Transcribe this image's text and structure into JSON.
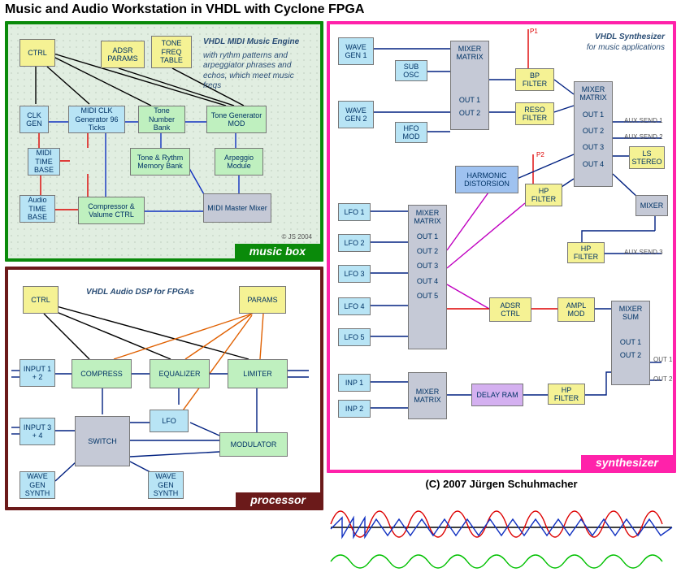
{
  "title": "Music and Audio Workstation in VHDL with Cyclone FPGA",
  "copyright": "(C) 2007 Jürgen Schuhmacher",
  "music_box": {
    "badge": "music box",
    "desc_title": "VHDL MIDI Music Engine",
    "desc_body": "with rythm patterns and arpeggiator phrases and echos, which meet music freqs",
    "footer": "© JS 2004",
    "b": {
      "ctrl": "CTRL",
      "adsr": "ADSR PARAMS",
      "tone_tab": "TONE FREQ TABLE",
      "clk": "CLK GEN",
      "midi_clk": "MIDI CLK Generator 96 Ticks",
      "tone_num": "Tone Number Bank",
      "tone_gen": "Tone Generator MOD",
      "midi_tb": "MIDI TIME BASE",
      "tone_mem": "Tone & Rythm Memory Bank",
      "arp": "Arpeggio Module",
      "audio_tb": "Audio TIME BASE",
      "comp": "Compressor & Valume CTRL",
      "mix": "MIDI Master Mixer"
    }
  },
  "processor": {
    "badge": "processor",
    "desc_title": "VHDL Audio DSP for FPGAs",
    "b": {
      "ctrl": "CTRL",
      "params": "PARAMS",
      "in12": "INPUT 1 + 2",
      "compress": "COMPRESS",
      "eq": "EQUALIZER",
      "lim": "LIMITER",
      "in34": "INPUT 3 + 4",
      "switch": "SWITCH",
      "lfo": "LFO",
      "mod": "MODULATOR",
      "wgs1": "WAVE GEN SYNTH",
      "wgs2": "WAVE GEN SYNTH"
    }
  },
  "synth": {
    "badge": "synthesizer",
    "desc_title": "VHDL Synthesizer",
    "desc_body": "for music applications",
    "labels": {
      "p1": "P1",
      "p2": "P2",
      "aux1": "AUX SEND 1",
      "aux2": "AUX SEND 2",
      "aux3": "AUX SEND 3",
      "out1": "OUT 1",
      "out2": "OUT 2"
    },
    "b": {
      "wg1": "WAVE GEN 1",
      "wg2": "WAVE GEN 2",
      "sub": "SUB OSC",
      "hfo": "HFO MOD",
      "mix1": "MIXER MATRIX OUT 1 OUT 2",
      "bp": "BP FILTER",
      "reso": "RESO FILTER",
      "mix2": "MIXER MATRIX OUT 1 OUT 2 OUT 3 OUT 4",
      "ls": "LS STEREO",
      "mixr": "MIXER",
      "harm": "HARMONIC DISTORSION",
      "hp1": "HP FILTER",
      "lfo1": "LFO 1",
      "lfo2": "LFO 2",
      "lfo3": "LFO 3",
      "lfo4": "LFO 4",
      "lfo5": "LFO 5",
      "mix3": "MIXER MATRIX OUT 1 OUT 2 OUT 3 OUT 4 OUT 5",
      "adsr": "ADSR CTRL",
      "ampl": "AMPL MOD",
      "hp2": "HP FILTER",
      "inp1": "INP 1",
      "inp2": "INP 2",
      "mix4": "MIXER MATRIX",
      "delay": "DELAY RAM",
      "hp3": "HP FILTER",
      "mixsum": "MIXER SUM OUT 1 OUT 2"
    }
  }
}
